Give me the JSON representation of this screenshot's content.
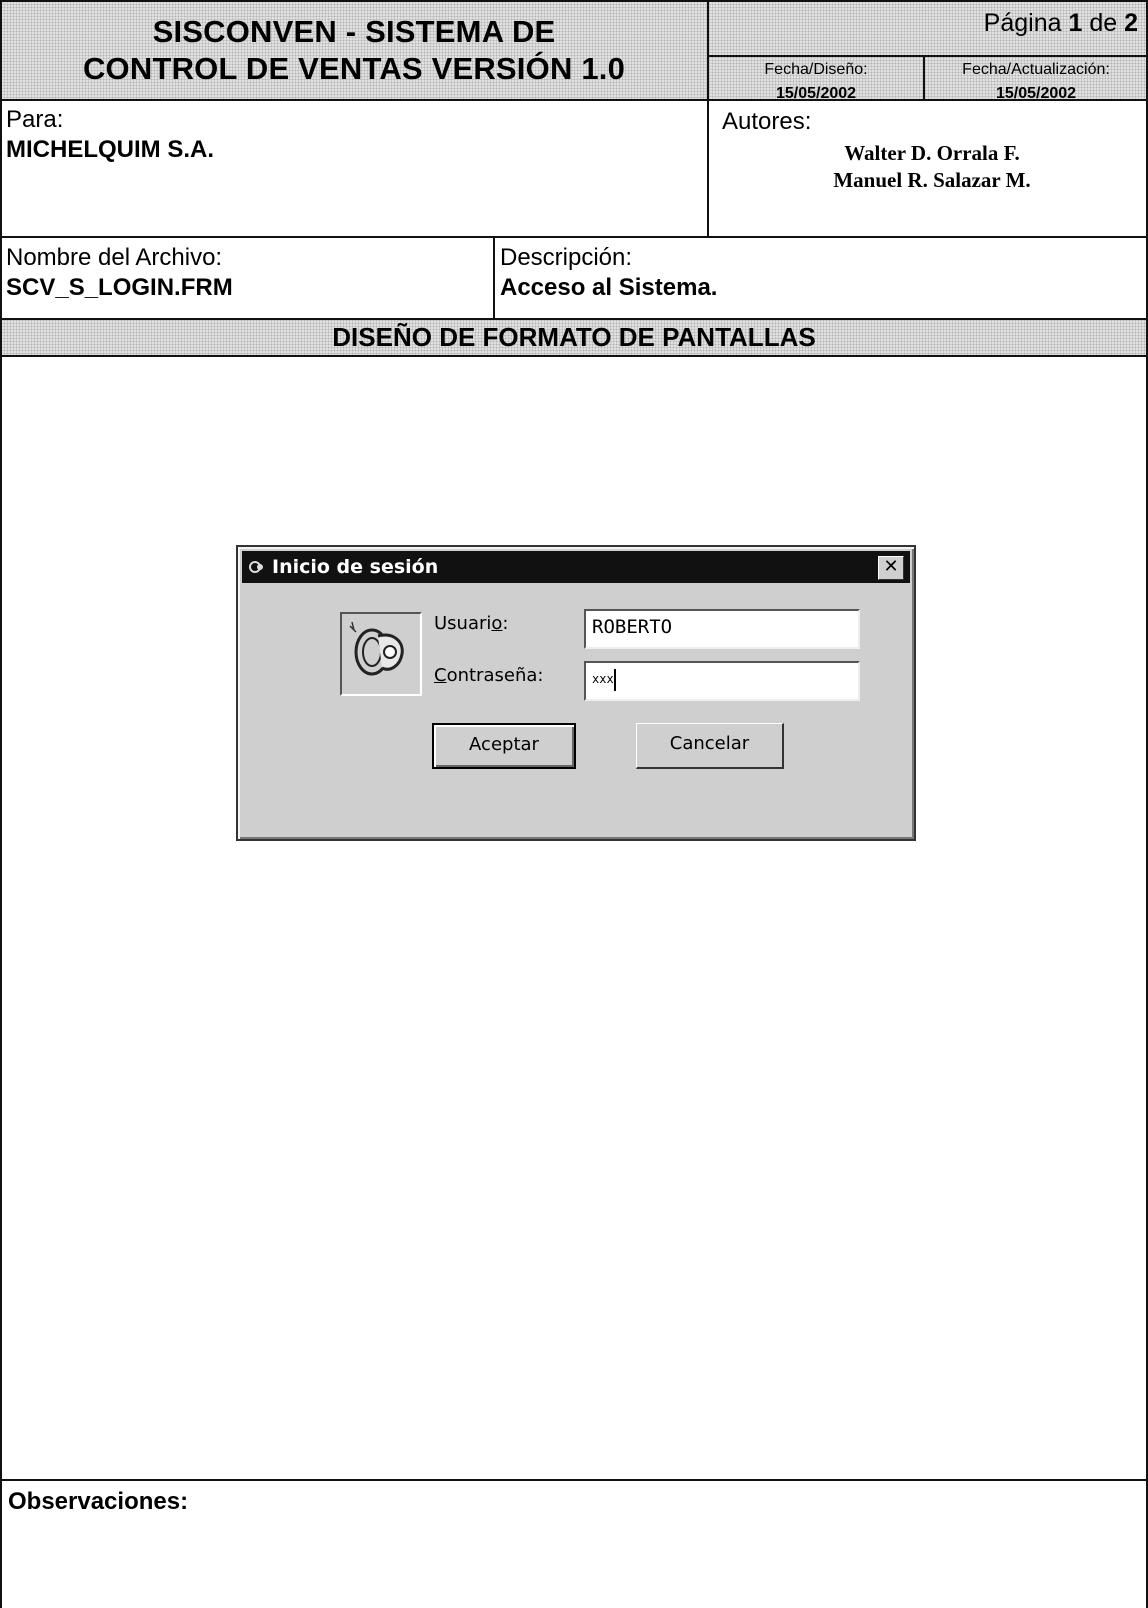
{
  "header": {
    "title_line1": "SISCONVEN - SISTEMA DE",
    "title_line2": "CONTROL DE VENTAS VERSIÓN 1.0",
    "page_label": "Página",
    "page_current": "1",
    "page_of": "de",
    "page_total": "2",
    "design_date_label": "Fecha/Diseño:",
    "design_date": "15/05/2002",
    "update_date_label": "Fecha/Actualización:",
    "update_date": "15/05/2002"
  },
  "info": {
    "for_label": "Para:",
    "for_value": "MICHELQUIM S.A.",
    "authors_label": "Autores:",
    "authors": [
      "Walter D. Orrala F.",
      "Manuel R. Salazar M."
    ],
    "file_label": "Nombre del Archivo:",
    "file_value": "SCV_S_LOGIN.FRM",
    "desc_label": "Descripción:",
    "desc_value": "Acceso al Sistema."
  },
  "section_title": "DISEÑO DE FORMATO DE PANTALLAS",
  "dialog": {
    "title": "Inicio de sesión",
    "close_glyph": "✕",
    "user_label_pre": "Usuari",
    "user_label_hot": "o",
    "user_label_post": ":",
    "user_value": "ROBERTO",
    "pass_label_hot": "C",
    "pass_label_post": "ontraseña:",
    "pass_value": "xxx",
    "accept_label": "Aceptar",
    "cancel_label": "Cancelar",
    "icon": "key-icon"
  },
  "observations_label": "Observaciones:"
}
